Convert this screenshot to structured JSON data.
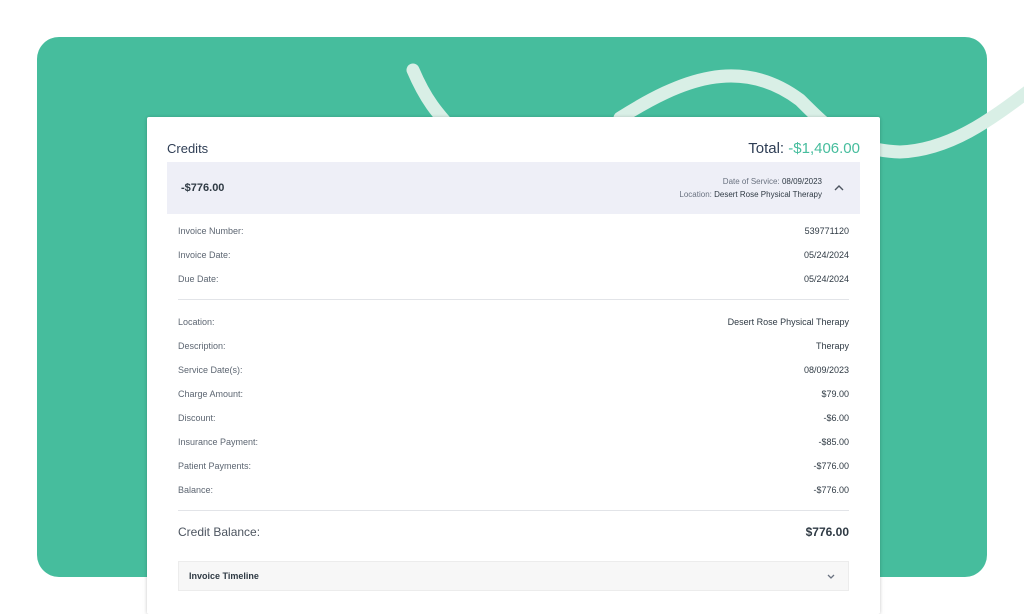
{
  "credits_title": "Credits",
  "total_label": "Total:",
  "total_amount": "-$1,406.00",
  "credit_item": {
    "amount": "-$776.00",
    "date_of_service_label": "Date of Service:",
    "date_of_service": "08/09/2023",
    "location_label": "Location:",
    "location": "Desert Rose Physical Therapy"
  },
  "invoice_rows": [
    {
      "label": "Invoice Number:",
      "value": "539771120"
    },
    {
      "label": "Invoice Date:",
      "value": "05/24/2024"
    },
    {
      "label": "Due Date:",
      "value": "05/24/2024"
    }
  ],
  "charge_rows": [
    {
      "label": "Location:",
      "value": "Desert Rose Physical Therapy"
    },
    {
      "label": "Description:",
      "value": "Therapy"
    },
    {
      "label": "Service Date(s):",
      "value": "08/09/2023"
    },
    {
      "label": "Charge Amount:",
      "value": "$79.00"
    },
    {
      "label": "Discount:",
      "value": "-$6.00"
    },
    {
      "label": "Insurance Payment:",
      "value": "-$85.00"
    },
    {
      "label": "Patient Payments:",
      "value": "-$776.00"
    },
    {
      "label": "Balance:",
      "value": "-$776.00"
    }
  ],
  "credit_balance": {
    "label": "Credit Balance:",
    "value": "$776.00"
  },
  "timeline_label": "Invoice Timeline",
  "colors": {
    "accent": "#46bd9d",
    "header_bg": "#eeeff7",
    "wave": "#d9efe6"
  }
}
